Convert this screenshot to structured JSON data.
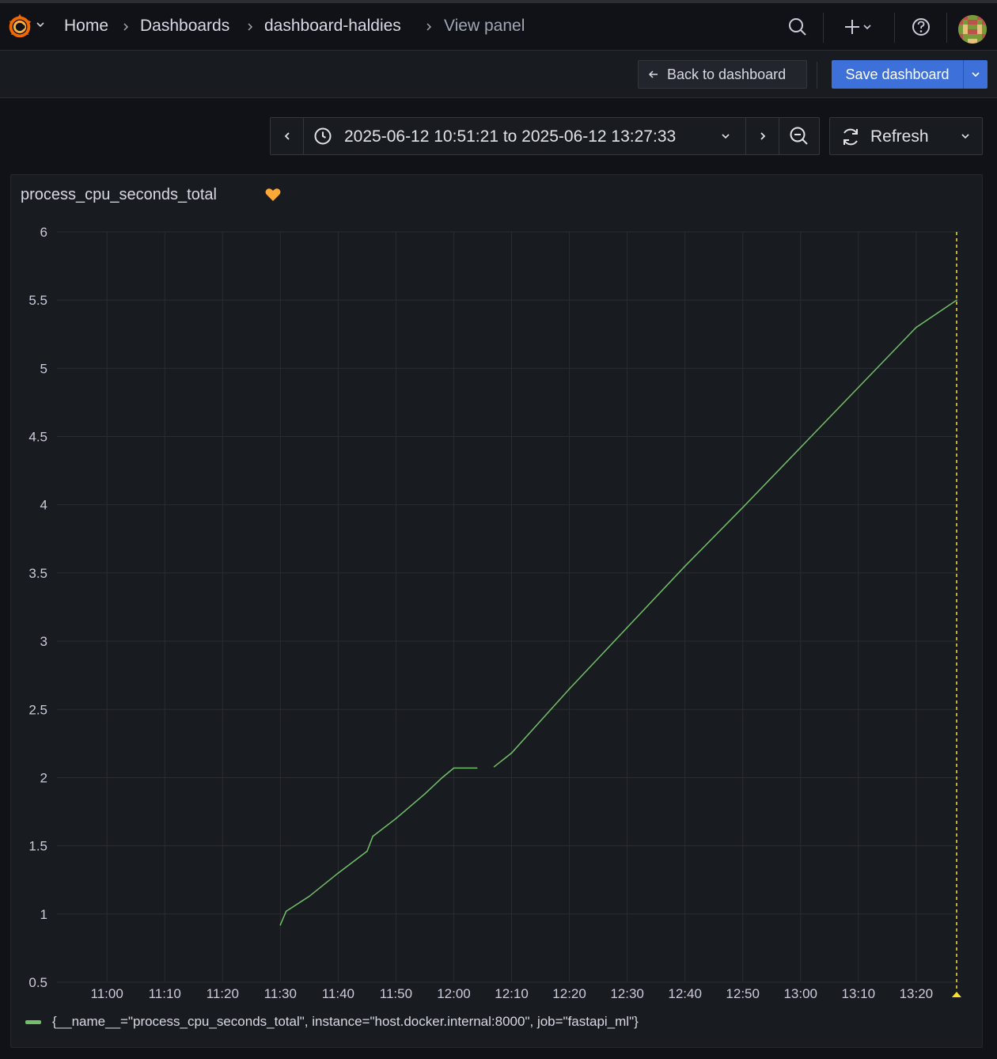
{
  "breadcrumb": {
    "items": [
      "Home",
      "Dashboards",
      "dashboard-haldies"
    ],
    "current": "View panel"
  },
  "toolbar": {
    "back_label": "Back to dashboard",
    "save_label": "Save dashboard"
  },
  "time_picker": {
    "range": "2025-06-12 10:51:21 to 2025-06-12 13:27:33",
    "refresh_label": "Refresh"
  },
  "colors": {
    "series": "#73bf69",
    "annotation": "#fade2a",
    "primary_button": "#3d71d9",
    "heart": "#ffa834"
  },
  "panel": {
    "title": "process_cpu_seconds_total",
    "title_icon": "heart-icon"
  },
  "chart_data": {
    "type": "line",
    "title": "process_cpu_seconds_total",
    "xlim": [
      "10:51:21",
      "13:27:33"
    ],
    "ylim": [
      0.5,
      6
    ],
    "yticks": [
      0.5,
      1,
      1.5,
      2,
      2.5,
      3,
      3.5,
      4,
      4.5,
      5,
      5.5,
      6
    ],
    "xticks": [
      "11:00",
      "11:10",
      "11:20",
      "11:30",
      "11:40",
      "11:50",
      "12:00",
      "12:10",
      "12:20",
      "12:30",
      "12:40",
      "12:50",
      "13:00",
      "13:10",
      "13:20"
    ],
    "grid": true,
    "legend_placement": "bottom",
    "annotation_time": "13:27",
    "series": [
      {
        "name": "{__name__=\"process_cpu_seconds_total\", instance=\"host.docker.internal:8000\", job=\"fastapi_ml\"}",
        "segments": [
          [
            {
              "x": "11:30",
              "y": 0.92
            },
            {
              "x": "11:31",
              "y": 1.02
            },
            {
              "x": "11:35",
              "y": 1.13
            },
            {
              "x": "11:40",
              "y": 1.3
            },
            {
              "x": "11:45",
              "y": 1.46
            },
            {
              "x": "11:46",
              "y": 1.57
            },
            {
              "x": "11:50",
              "y": 1.7
            },
            {
              "x": "11:55",
              "y": 1.88
            },
            {
              "x": "11:58",
              "y": 2.0
            },
            {
              "x": "12:00",
              "y": 2.07
            },
            {
              "x": "12:04",
              "y": 2.07
            }
          ],
          [
            {
              "x": "12:07",
              "y": 2.08
            },
            {
              "x": "12:10",
              "y": 2.18
            },
            {
              "x": "12:20",
              "y": 2.65
            },
            {
              "x": "12:30",
              "y": 3.1
            },
            {
              "x": "12:40",
              "y": 3.55
            },
            {
              "x": "12:50",
              "y": 3.98
            },
            {
              "x": "13:00",
              "y": 4.42
            },
            {
              "x": "13:10",
              "y": 4.86
            },
            {
              "x": "13:20",
              "y": 5.3
            },
            {
              "x": "13:27",
              "y": 5.5
            }
          ]
        ]
      }
    ]
  }
}
